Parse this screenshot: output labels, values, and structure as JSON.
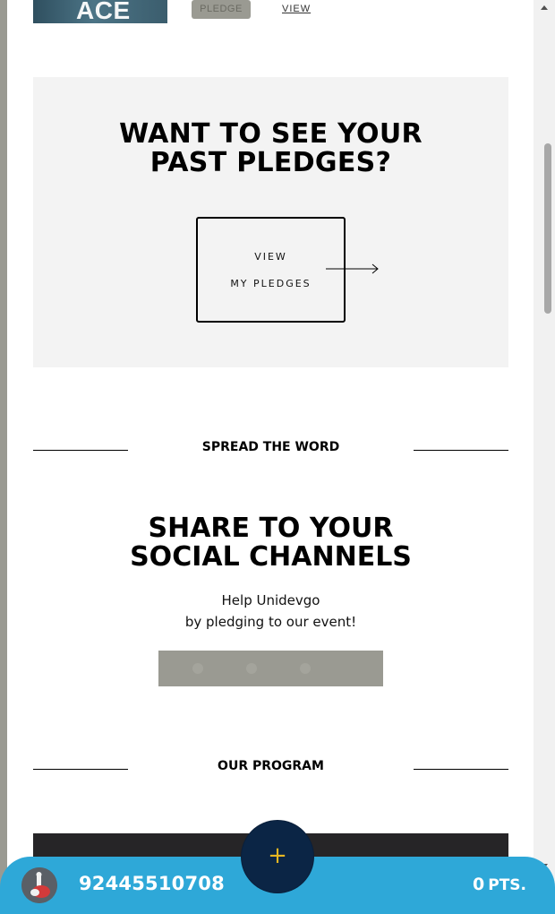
{
  "card": {
    "image_text": "ACE",
    "pledge_label": "PLEDGE",
    "view_label": "VIEW"
  },
  "past_pledges": {
    "title_line1": "WANT TO SEE YOUR",
    "title_line2": "PAST PLEDGES?",
    "button_line1": "VIEW",
    "button_line2": "MY PLEDGES"
  },
  "spread": {
    "heading": "SPREAD THE WORD",
    "title_line1": "SHARE TO YOUR",
    "title_line2": "SOCIAL CHANNELS",
    "subtitle_line1": "Help Unidevgo",
    "subtitle_line2": "by pledging to our event!"
  },
  "program": {
    "heading": "OUR PROGRAM"
  },
  "bottom_bar": {
    "phone": "92445510708",
    "points_value": "0",
    "points_unit": "PTS.",
    "fab_icon": "plus-icon"
  },
  "colors": {
    "accent_blue": "#2ea8d8",
    "fab_navy": "#0b2545",
    "fab_plus": "#e7b722",
    "muted_gray": "#9a9a92"
  }
}
